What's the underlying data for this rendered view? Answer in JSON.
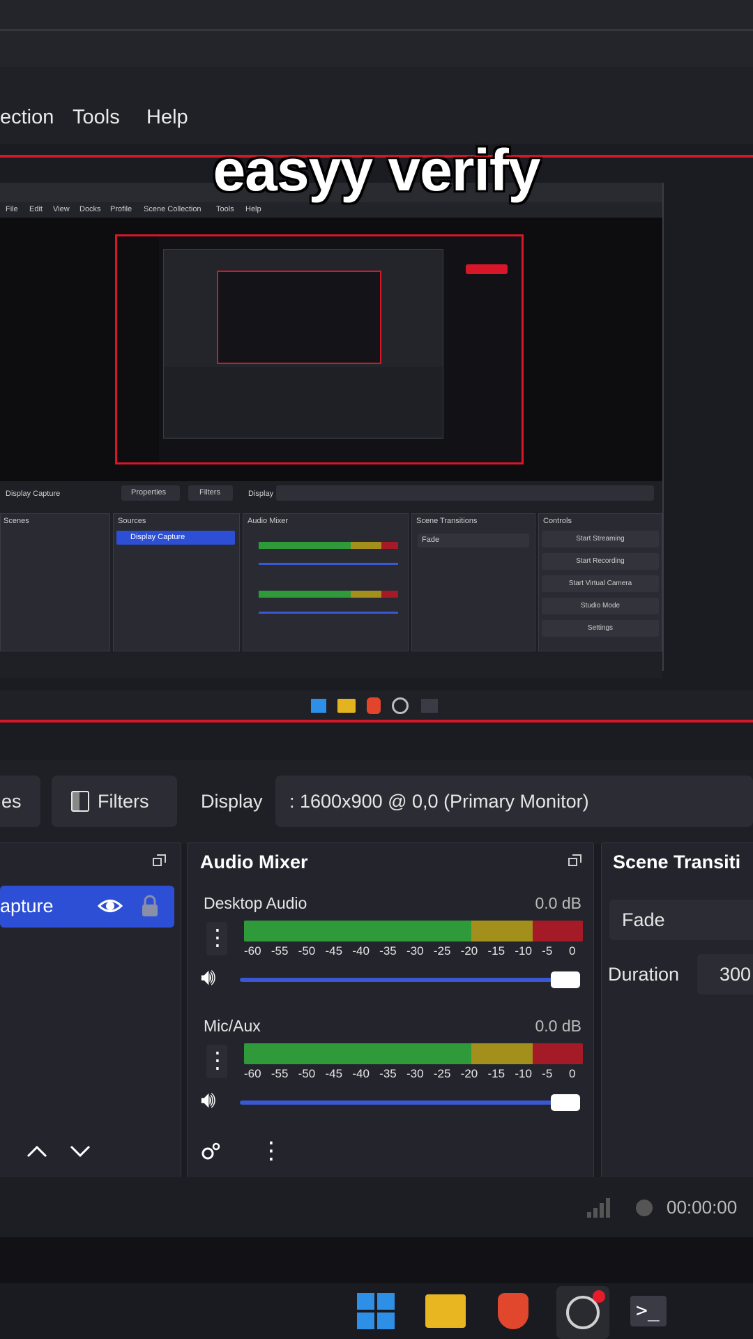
{
  "overlay": {
    "caption": "easyy verify"
  },
  "menu": {
    "items": [
      "ection",
      "Tools",
      "Help"
    ]
  },
  "inner_preview": {
    "menus": [
      "File",
      "Edit",
      "View",
      "Docks",
      "Profile",
      "Scene Collection",
      "Tools",
      "Help"
    ],
    "toolbar": {
      "source": "Display Capture",
      "properties": "Properties",
      "filters": "Filters",
      "display_label": "Display"
    },
    "docks": [
      "Scenes",
      "Sources",
      "Audio Mixer",
      "Scene Transitions",
      "Controls"
    ],
    "sources_item": "Display Capture",
    "transition": "Fade",
    "controls": [
      "Start Streaming",
      "Start Recording",
      "Start Virtual Camera",
      "Studio Mode",
      "Settings"
    ]
  },
  "toolbar": {
    "properties_partial": "es",
    "filters_label": "Filters",
    "display_label": "Display",
    "display_value": ": 1600x900 @ 0,0 (Primary Monitor)"
  },
  "sources": {
    "item_label": "apture"
  },
  "audio_mixer": {
    "title": "Audio Mixer",
    "channels": [
      {
        "name": "Desktop Audio",
        "db": "0.0 dB",
        "volume": 1.0
      },
      {
        "name": "Mic/Aux",
        "db": "0.0 dB",
        "volume": 1.0
      }
    ],
    "scale": [
      "-60",
      "-55",
      "-50",
      "-45",
      "-40",
      "-35",
      "-30",
      "-25",
      "-20",
      "-15",
      "-10",
      "-5",
      "0"
    ]
  },
  "scene_transitions": {
    "title": "Scene Transiti",
    "transition": "Fade",
    "duration_label": "Duration",
    "duration_value": "300"
  },
  "status": {
    "time": "00:00:00"
  },
  "colors": {
    "accent_red": "#d8162a",
    "selection_blue": "#2c4fd6",
    "meter_green": "#2e9a3a",
    "meter_yellow": "#a38f1c",
    "meter_red": "#a41a26"
  },
  "taskbar": {
    "icons": [
      "windows-start-icon",
      "file-explorer-icon",
      "brave-browser-icon",
      "obs-studio-icon",
      "terminal-icon"
    ]
  }
}
